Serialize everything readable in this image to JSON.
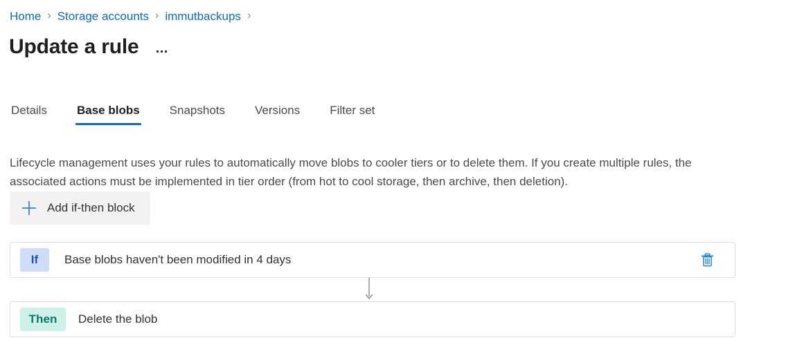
{
  "breadcrumb": {
    "separator": "›",
    "items": [
      {
        "label": "Home"
      },
      {
        "label": "Storage accounts"
      },
      {
        "label": "immutbackups"
      }
    ]
  },
  "header": {
    "title": "Update a rule",
    "more_menu": "…"
  },
  "tabs": [
    {
      "label": "Details",
      "active": false
    },
    {
      "label": "Base blobs",
      "active": true
    },
    {
      "label": "Snapshots",
      "active": false
    },
    {
      "label": "Versions",
      "active": false
    },
    {
      "label": "Filter set",
      "active": false
    }
  ],
  "main": {
    "description": "Lifecycle management uses your rules to automatically move blobs to cooler tiers or to delete them. If you create multiple rules, the associated actions must be implemented in tier order (from hot to cool storage, then archive, then deletion).",
    "add_block_label": "Add if-then block",
    "add_block_icon": "plus-icon"
  },
  "rule": {
    "if": {
      "badge": "If",
      "text": "Base blobs haven't been modified in 4 days",
      "delete_icon": "trash-icon"
    },
    "then": {
      "badge": "Then",
      "text": "Delete the blob"
    }
  },
  "colors": {
    "link": "#0f6cbd",
    "tab_active_underline": "#0f6cbd",
    "if_badge_bg": "#cfdcf7",
    "if_badge_text": "#1a56c4",
    "then_badge_bg": "#cdf0e8",
    "then_badge_text": "#0b7a6b",
    "delete_icon": "#2489d8",
    "plus_icon": "#4a90d2",
    "button_bg": "#f3f2f1",
    "card_border": "#e1dfdd",
    "connector": "#8a8886"
  }
}
